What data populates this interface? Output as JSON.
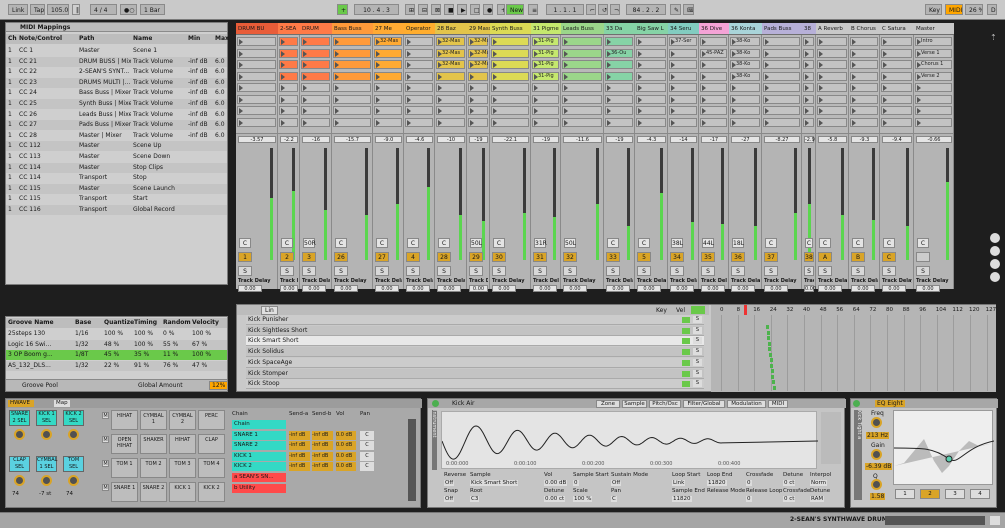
{
  "transport": {
    "link": "Link",
    "tap": "Tap",
    "tempo": "105.00",
    "signature": "4 / 4",
    "metronome": "●○",
    "quantize": "1 Bar",
    "position": "10 . 4 . 3",
    "new": "New",
    "loop_start": "1 . 1 . 1",
    "loop_length": "84 . 2 . 2",
    "key": "Key",
    "midi": "MIDI",
    "cpu": "26 %",
    "d": "D"
  },
  "midi_mappings": {
    "title": "MIDI Mappings",
    "columns": [
      "Ch",
      "Note/Control",
      "Path",
      "Name",
      "Min",
      "Max"
    ],
    "rows": [
      [
        "1",
        "CC 1",
        "Master",
        "Scene 1",
        "",
        ""
      ],
      [
        "1",
        "CC 21",
        "DRUM BUSS | Mixer",
        "Track Volume",
        "-inf dB",
        "6.0"
      ],
      [
        "1",
        "CC 22",
        "2-SEAN'S SYNT...",
        "Track Volume",
        "-inf dB",
        "6.0"
      ],
      [
        "1",
        "CC 23",
        "DRUMS MULTI |...",
        "Track Volume",
        "-inf dB",
        "6.0"
      ],
      [
        "1",
        "CC 24",
        "Bass Buss | Mixer",
        "Track Volume",
        "-inf dB",
        "6.0"
      ],
      [
        "1",
        "CC 25",
        "Synth Buss | Mixer",
        "Track Volume",
        "-inf dB",
        "6.0"
      ],
      [
        "1",
        "CC 26",
        "Leads Buss | Mixer",
        "Track Volume",
        "-inf dB",
        "6.0"
      ],
      [
        "1",
        "CC 27",
        "Pads Buss | Mixer",
        "Track Volume",
        "-inf dB",
        "6.0"
      ],
      [
        "1",
        "CC 28",
        "Master | Mixer",
        "Track Volume",
        "-inf dB",
        "6.0"
      ],
      [
        "1",
        "CC 112",
        "Master",
        "Scene Up",
        "",
        ""
      ],
      [
        "1",
        "CC 113",
        "Master",
        "Scene Down",
        "",
        ""
      ],
      [
        "1",
        "CC 114",
        "Master",
        "Stop Clips",
        "",
        ""
      ],
      [
        "1",
        "CC 114",
        "Transport",
        "Stop",
        "",
        ""
      ],
      [
        "1",
        "CC 115",
        "Master",
        "Scene Launch",
        "",
        ""
      ],
      [
        "1",
        "CC 115",
        "Transport",
        "Start",
        "",
        ""
      ],
      [
        "1",
        "CC 116",
        "Transport",
        "Global Record",
        "",
        ""
      ]
    ]
  },
  "groove_pool": {
    "title": "Groove Pool",
    "columns": [
      "Groove Name",
      "Base",
      "Quantize",
      "Timing",
      "Random",
      "Velocity"
    ],
    "rows": [
      [
        "25steps 130",
        "1/16",
        "100 %",
        "100 %",
        "0 %",
        "100 %"
      ],
      [
        "Logic 16 Swi...",
        "1/32",
        "48 %",
        "100 %",
        "55 %",
        "67 %"
      ],
      [
        "3 OP Boom g...",
        "1/8T",
        "45 %",
        "35 %",
        "11 %",
        "100 %"
      ],
      [
        "AS_132_DLS...",
        "1/32",
        "22 %",
        "91 %",
        "76 %",
        "47 %"
      ]
    ],
    "global_amount_label": "Global Amount",
    "global_amount": "12%"
  },
  "tracks": [
    {
      "name": "DRUM BU",
      "color": "#e85c38",
      "vol": "-3.57",
      "pan": "C",
      "num": "1",
      "delay": "0.00",
      "clips": [
        "",
        "",
        "",
        ""
      ]
    },
    {
      "name": "2-SEA",
      "color": "#ff7a47",
      "vol": "-2.2",
      "pan": "C",
      "num": "2",
      "delay": "0.00",
      "clips": [
        "",
        "",
        "",
        ""
      ]
    },
    {
      "name": "DRUM",
      "color": "#ff7a47",
      "vol": "-16",
      "pan": "50R",
      "num": "3",
      "delay": "0.00",
      "clips": [
        "",
        "",
        "",
        ""
      ]
    },
    {
      "name": "Bass Buss",
      "color": "#ff9a3a",
      "vol": "-15.7",
      "pan": "C",
      "num": "26",
      "delay": "0.00",
      "clips": [
        "",
        "",
        "",
        ""
      ]
    },
    {
      "name": "27 Me",
      "color": "#ffaa33",
      "vol": "-9.0",
      "pan": "C",
      "num": "27",
      "delay": "0.00",
      "clips": [
        "32-Mas",
        "",
        "",
        ""
      ]
    },
    {
      "name": "Operator",
      "color": "#ffad2e",
      "vol": "-4.6",
      "pan": "C",
      "num": "4",
      "delay": "0.00",
      "clips": [
        "",
        "",
        "",
        ""
      ]
    },
    {
      "name": "28 Baz",
      "color": "#e3c44b",
      "vol": "-10",
      "pan": "C",
      "num": "28",
      "delay": "0.00",
      "clips": [
        "32-Mas",
        "32-Mas",
        "32-Mas",
        ""
      ]
    },
    {
      "name": "29 Massi",
      "color": "#e3c44b",
      "vol": "-19",
      "pan": "50L",
      "num": "29",
      "delay": "0.00",
      "clips": [
        "32-Mas",
        "32-Mas",
        "32-Mas",
        ""
      ]
    },
    {
      "name": "Synth Buss",
      "color": "#dcda55",
      "vol": "-22.1",
      "pan": "C",
      "num": "30",
      "delay": "0.00",
      "clips": [
        "",
        "",
        "",
        ""
      ]
    },
    {
      "name": "31 Pigme",
      "color": "#c5e86e",
      "vol": "-19",
      "pan": "31R",
      "num": "31",
      "delay": "0.00",
      "clips": [
        "31-Pig",
        "31-Pig",
        "31-Pig",
        "31-Pig"
      ]
    },
    {
      "name": "Leads Buss",
      "color": "#9bd68a",
      "vol": "-11.6",
      "pan": "50L",
      "num": "32",
      "delay": "0.00",
      "clips": [
        "",
        "",
        "",
        ""
      ]
    },
    {
      "name": "33 Da",
      "color": "#86d3a6",
      "vol": "-19",
      "pan": "C",
      "num": "33",
      "delay": "0.00",
      "clips": [
        "",
        "36-Ou",
        "",
        ""
      ]
    },
    {
      "name": "Big Saw L",
      "color": "#86d3a6",
      "vol": "-4.3",
      "pan": "C",
      "num": "5",
      "delay": "0.00",
      "clips": [
        "",
        "",
        "",
        ""
      ]
    },
    {
      "name": "34 Seru",
      "color": "#82ccc0",
      "vol": "-14",
      "pan": "38L",
      "num": "34",
      "delay": "0.00",
      "clips": [
        "37-Ser",
        "",
        "",
        ""
      ]
    },
    {
      "name": "36 Dive",
      "color": "#f4a3d6",
      "vol": "-17",
      "pan": "44L",
      "num": "35",
      "delay": "0.00",
      "clips": [
        "",
        "45-PAZ",
        "",
        ""
      ]
    },
    {
      "name": "36 Konta",
      "color": "#a9d4d9",
      "vol": "-27",
      "pan": "18L",
      "num": "36",
      "delay": "0.00",
      "clips": [
        "38-Ko",
        "38-Ko",
        "38-Ko",
        "38-Ko"
      ]
    },
    {
      "name": "Pads Buss",
      "color": "#b7b0d8",
      "vol": "-8.27",
      "pan": "C",
      "num": "37",
      "delay": "0.00",
      "clips": [
        "",
        "",
        "",
        ""
      ]
    },
    {
      "name": "38",
      "color": "#b7b0d8",
      "vol": "-2.9",
      "pan": "C",
      "num": "38",
      "delay": "0.00",
      "clips": [
        "",
        "",
        "",
        ""
      ]
    },
    {
      "name": "A Reverb",
      "color": "#c8c8c8",
      "vol": "-5.8",
      "pan": "C",
      "num": "A",
      "delay": "0.00",
      "clips": [
        "",
        "",
        "",
        ""
      ]
    },
    {
      "name": "B Chorus",
      "color": "#c8c8c8",
      "vol": "-9.3",
      "pan": "C",
      "num": "B",
      "delay": "0.00",
      "clips": [
        "",
        "",
        "",
        ""
      ]
    },
    {
      "name": "C Satura",
      "color": "#c8c8c8",
      "vol": "-9.4",
      "pan": "C",
      "num": "C",
      "delay": "0.00",
      "clips": [
        "",
        "",
        "",
        ""
      ]
    },
    {
      "name": "Master",
      "color": "#c8c8c8",
      "vol": "-0.66",
      "pan": "C",
      "num": "",
      "delay": "0.00",
      "clips": [
        "Intro",
        "Verse 1",
        "Chorus 1",
        "Verse 2"
      ]
    }
  ],
  "scenes": [
    "Intro",
    "Verse 1",
    "Chorus 1",
    "Verse 2",
    "Chorus 2"
  ],
  "track_delay_label": "Track Delay",
  "ms_label": "ms",
  "drum_rack": {
    "key_label": "Key",
    "vel_label": "Vel",
    "mode": "Lin",
    "rows": [
      "Kick Punisher",
      "Kick Sightless Short",
      "Kick Smart Short",
      "Kick Solidus",
      "Kick SpaceAge",
      "Kick Stomper",
      "Kick Stoop"
    ],
    "ruler": [
      "0",
      "8",
      "16",
      "24",
      "32",
      "40",
      "48",
      "56",
      "64",
      "72",
      "80",
      "88",
      "96",
      "104",
      "112",
      "120",
      "127"
    ]
  },
  "instrument": {
    "title": "HWAVE",
    "map": "Map",
    "pads": [
      "SNARE 2 SEL",
      "KICK 1 SEL",
      "KICK 2 SEL",
      "CLAP SEL",
      "CYMBAL 1 SEL",
      "TOM SEL"
    ],
    "knob_values": [
      "74",
      "-7 st",
      "74"
    ],
    "grid": [
      [
        "HIHAT",
        "CYMBAL 1",
        "CYMBAL 2",
        "PERC"
      ],
      [
        "OPEN HIHAT",
        "SHAKER",
        "HIHAT",
        "CLAP"
      ],
      [
        "TOM 1",
        "TOM 2",
        "TOM 3",
        "TOM 4"
      ],
      [
        "SNARE 1",
        "SNARE 2",
        "KICK 1",
        "KICK 2"
      ]
    ],
    "chain_head": [
      "Chain",
      "Send-a",
      "Send-b",
      "Vol",
      "Pan"
    ],
    "chains": [
      "Chain",
      "SNARE 1",
      "SNARE 2",
      "KICK 1",
      "KICK 2",
      "a SEAN'S SN...",
      "b Utility"
    ],
    "chain_val": "-inf dB",
    "chain_vol": "0.0 dB"
  },
  "sampler": {
    "title": "Kick Air",
    "tabs": [
      "Zone",
      "Sample",
      "Pitch/Osc",
      "Filter/Global",
      "Modulation",
      "MIDI"
    ],
    "time_marks": [
      "0:00:000",
      "0:00:100",
      "0:00:200",
      "0:00:300",
      "0:00:400"
    ],
    "params": [
      "Reverse",
      "Sample",
      "Vol",
      "Sample Start",
      "Sustain Mode",
      "Loop Start",
      "Loop End",
      "Crossfade",
      "Detune",
      "Interpol"
    ],
    "param_values": [
      "Off",
      "Kick Smart Short",
      "0.00 dB",
      "0",
      "Off",
      "Link",
      "11820",
      "0",
      "0 ct",
      "Norm"
    ],
    "params2": [
      "Snap",
      "Root",
      "Detune",
      "Scale",
      "Pan",
      "Sample End",
      "Release Mode",
      "Release Loop",
      "Crossfade",
      "Detune"
    ],
    "param_values2": [
      "Off",
      "C3",
      "0.00 ct",
      "100 %",
      "C",
      "11820",
      "",
      "0",
      "0 ct",
      "RAM"
    ]
  },
  "eq": {
    "title": "EQ Eight",
    "freq_label": "Freq",
    "freq": "213 Hz",
    "gain_label": "Gain",
    "gain": "-6.39 dB",
    "q_label": "Q",
    "q": "1.58",
    "bands": [
      "1",
      "2",
      "3",
      "4"
    ]
  },
  "status": {
    "name": "2-SEAN'S SYNTHWAVE DRUMS-2"
  }
}
